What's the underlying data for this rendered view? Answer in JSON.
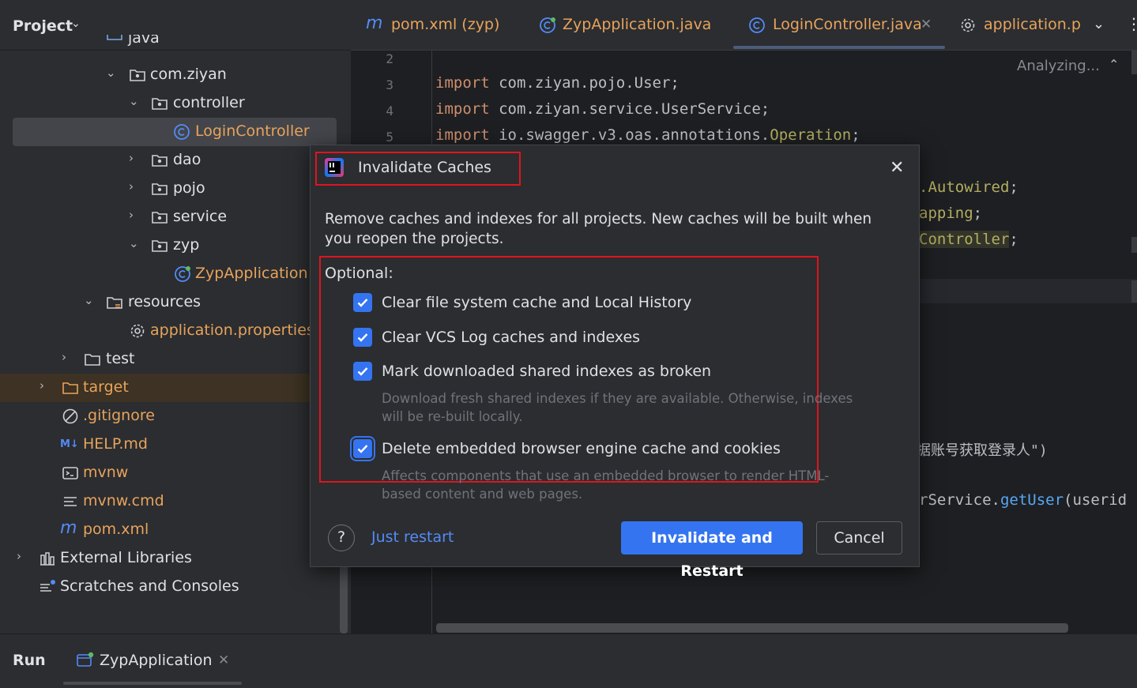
{
  "project_panel": {
    "title": "Project",
    "tree": [
      {
        "label": "java",
        "kind": "folder"
      },
      {
        "label": "com.ziyan",
        "kind": "package"
      },
      {
        "label": "controller",
        "kind": "package"
      },
      {
        "label": "LoginController",
        "kind": "class",
        "selected": true
      },
      {
        "label": "dao",
        "kind": "package"
      },
      {
        "label": "pojo",
        "kind": "package"
      },
      {
        "label": "service",
        "kind": "package"
      },
      {
        "label": "zyp",
        "kind": "package"
      },
      {
        "label": "ZypApplication",
        "kind": "spring-class"
      },
      {
        "label": "resources",
        "kind": "resources-folder"
      },
      {
        "label": "application.properties",
        "kind": "properties"
      },
      {
        "label": "test",
        "kind": "folder"
      },
      {
        "label": "target",
        "kind": "excluded-folder"
      },
      {
        "label": ".gitignore",
        "kind": "ignore-file"
      },
      {
        "label": "HELP.md",
        "kind": "markdown"
      },
      {
        "label": "mvnw",
        "kind": "script"
      },
      {
        "label": "mvnw.cmd",
        "kind": "text"
      },
      {
        "label": "pom.xml",
        "kind": "maven"
      },
      {
        "label": "External Libraries",
        "kind": "libraries"
      },
      {
        "label": "Scratches and Consoles",
        "kind": "scratches"
      }
    ]
  },
  "editor": {
    "tabs": [
      {
        "label": "pom.xml (zyp)",
        "icon": "maven-icon"
      },
      {
        "label": "ZypApplication.java",
        "icon": "spring-class-icon"
      },
      {
        "label": "LoginController.java",
        "icon": "class-icon",
        "active": true
      },
      {
        "label": "application.p",
        "icon": "gear-icon"
      }
    ],
    "status": "Analyzing...",
    "line_numbers": [
      "2",
      "3",
      "4",
      "5"
    ],
    "lines": [
      {
        "kw": "import",
        "rest": " com.ziyan.pojo.User;"
      },
      {
        "kw": "import",
        "rest": " com.ziyan.service.UserService;"
      },
      {
        "kw": "import",
        "rest": " io.swagger.v3.oas.annotations.",
        "ann": "Operation",
        "end": ";"
      }
    ],
    "fragments": {
      "autowired": ".Autowired",
      "mapping": "apping",
      "controller": "Controller",
      "semi": ";",
      "chinese": "据账号获取登录人\")",
      "service_call_a": "rService.",
      "service_call_b": "getUser",
      "service_call_c": "(userid"
    }
  },
  "dialog": {
    "title": "Invalidate Caches",
    "description": "Remove caches and indexes for all projects. New caches will be built when you reopen the projects.",
    "optional_label": "Optional:",
    "options": [
      {
        "label": "Clear file system cache and Local History",
        "checked": true,
        "hint": ""
      },
      {
        "label": "Clear VCS Log caches and indexes",
        "checked": true,
        "hint": ""
      },
      {
        "label": "Mark downloaded shared indexes as broken",
        "checked": true,
        "hint": "Download fresh shared indexes if they are available. Otherwise, indexes will be re-built locally."
      },
      {
        "label": "Delete embedded browser engine cache and cookies",
        "checked": true,
        "hint": "Affects components that use an embedded browser to render HTML-based content and web pages."
      }
    ],
    "help": "?",
    "just_restart": "Just restart",
    "primary_button": "Invalidate and Restart",
    "cancel_button": "Cancel"
  },
  "run_bar": {
    "title": "Run",
    "tab_label": "ZypApplication"
  },
  "colors": {
    "accent": "#3574f0",
    "highlight_box": "#e0141e",
    "excluded_orange": "#e8a35c"
  }
}
